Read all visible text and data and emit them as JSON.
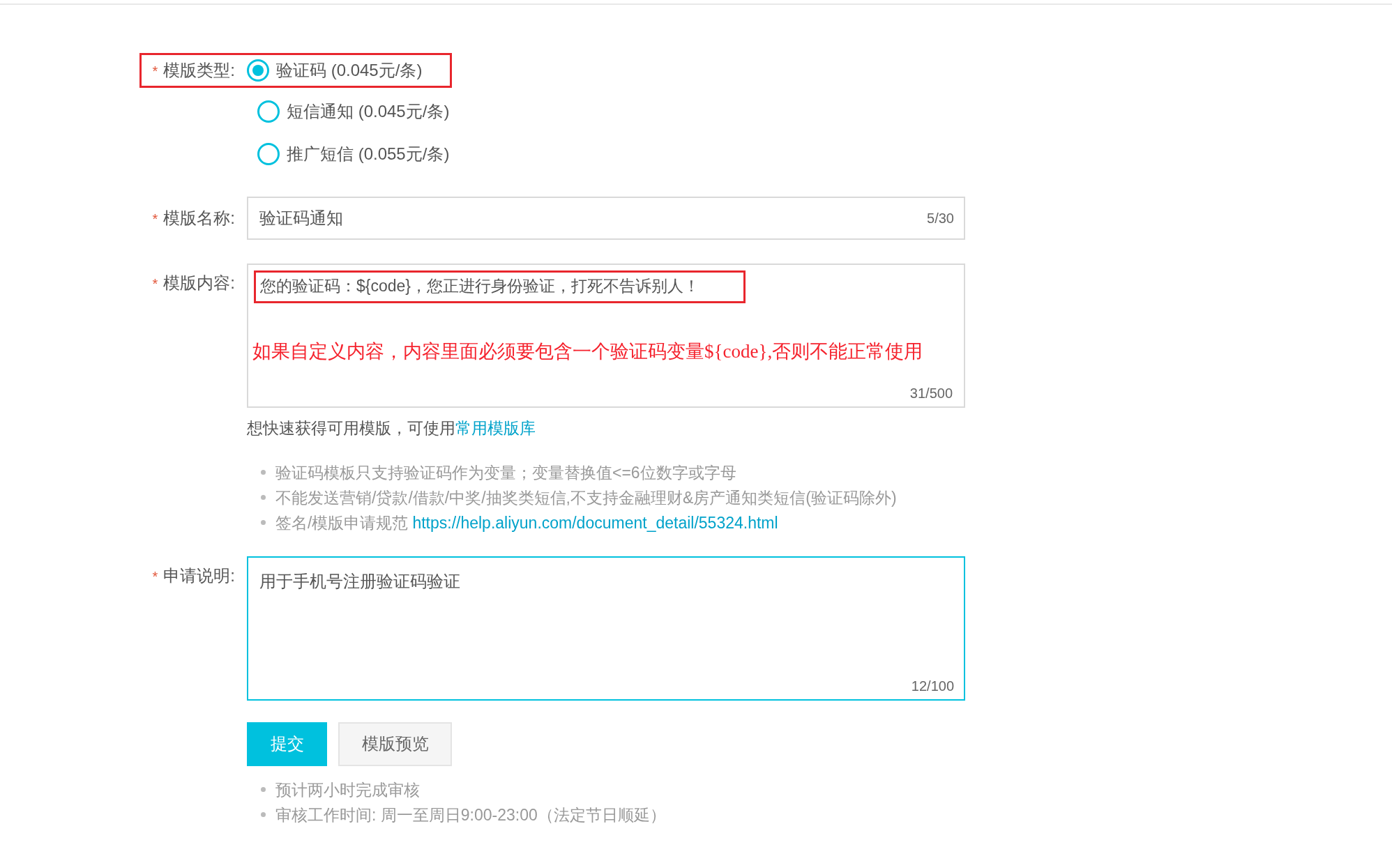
{
  "template_type": {
    "label": "模版类型:",
    "required_mark": "*",
    "highlighted": true,
    "options": [
      {
        "label": "验证码 (0.045元/条)",
        "selected": true
      },
      {
        "label": "短信通知 (0.045元/条)",
        "selected": false
      },
      {
        "label": "推广短信 (0.055元/条)",
        "selected": false
      }
    ]
  },
  "template_name": {
    "label": "模版名称:",
    "required_mark": "*",
    "value": "验证码通知",
    "counter": "5/30"
  },
  "template_content": {
    "label": "模版内容:",
    "required_mark": "*",
    "value": "您的验证码：${code}，您正进行身份验证，打死不告诉别人！",
    "highlighted": true,
    "annotation": "如果自定义内容，内容里面必须要包含一个验证码变量${code},否则不能正常使用",
    "counter": "31/500"
  },
  "library_hint": {
    "text": "想快速获得可用模版，可使用",
    "link": "常用模版库"
  },
  "notes": [
    {
      "text": "验证码模板只支持验证码作为变量；变量替换值<=6位数字或字母"
    },
    {
      "text": "不能发送营销/贷款/借款/中奖/抽奖类短信,不支持金融理财&房产通知类短信(验证码除外)"
    },
    {
      "text": "签名/模版申请规范",
      "link": "https://help.aliyun.com/document_detail/55324.html"
    }
  ],
  "application": {
    "label": "申请说明:",
    "required_mark": "*",
    "value": "用于手机号注册验证码验证",
    "counter": "12/100",
    "focused": true
  },
  "buttons": [
    {
      "label": "提交",
      "kind": "primary"
    },
    {
      "label": "模版预览",
      "kind": "default"
    }
  ],
  "footer_notes": [
    "预计两小时完成审核",
    "审核工作时间: 周一至周日9:00-23:00（法定节日顺延）"
  ]
}
